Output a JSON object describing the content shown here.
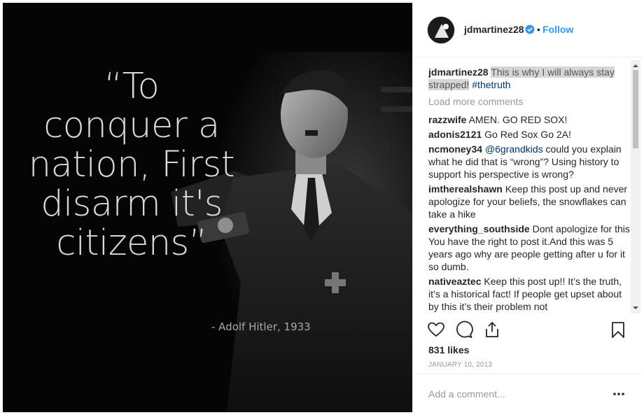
{
  "post": {
    "image": {
      "quote_lines": [
        "“To",
        "conquer a",
        "nation, First",
        "disarm it's",
        "citizens”"
      ],
      "attribution": "- Adolf Hitler, 1933"
    },
    "header": {
      "username": "jdmartinez28",
      "verified_icon": "verified-badge-icon",
      "separator": "•",
      "follow_label": "Follow"
    },
    "caption": {
      "username": "jdmartinez28",
      "text": "This is why I will always stay strapped!",
      "hashtag": "#thetruth"
    },
    "load_more": "Load more comments",
    "comments": [
      {
        "user": "razzwife",
        "text": "AMEN. GO RED SOX!"
      },
      {
        "user": "adonis2121",
        "text": "Go Red Sox Go 2A!"
      },
      {
        "user": "ncmoney34",
        "mention": "@6grandkids",
        "text": "could you explain what he did that is “wrong”? Using history to support his perspective is wrong?"
      },
      {
        "user": "imtherealshawn",
        "text": "Keep this post up and never apologize for your beliefs, the snowflakes can take a hike"
      },
      {
        "user": "everything_southside",
        "text": "Dont apologize for this You have the right to post it.And this was 5 years ago why are people getting after u for it so dumb."
      },
      {
        "user": "nativeaztec",
        "text": "Keep this post up!! It’s the truth, it’s a historical fact! If people get upset about by this it’s their problem not"
      }
    ],
    "actions": {
      "like_icon": "heart-icon",
      "comment_icon": "comment-icon",
      "share_icon": "share-icon",
      "save_icon": "bookmark-icon"
    },
    "likes": "831 likes",
    "date": "JANUARY 10, 2013",
    "add_comment_placeholder": "Add a comment...",
    "more_icon": "more-options-icon",
    "colors": {
      "link_blue": "#3897f0",
      "hashtag": "#003569",
      "muted": "#999999"
    }
  }
}
